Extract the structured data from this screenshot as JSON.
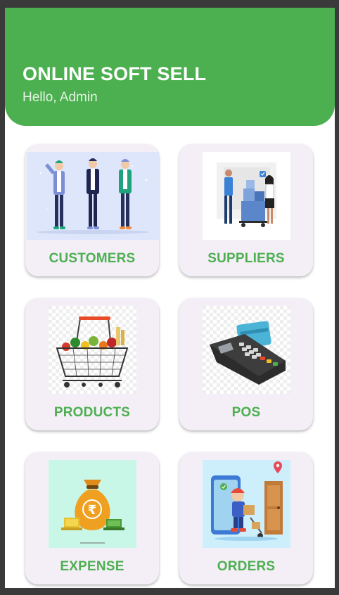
{
  "header": {
    "title": "ONLINE SOFT SELL",
    "greeting": "Hello, Admin",
    "background_color": "#4caf50"
  },
  "menu": {
    "label_color": "#4caf50",
    "card_color": "#f4eff7",
    "items": [
      {
        "label": "CUSTOMERS",
        "icon": "customers-illustration-icon"
      },
      {
        "label": "SUPPLIERS",
        "icon": "suppliers-illustration-icon"
      },
      {
        "label": "PRODUCTS",
        "icon": "shopping-basket-icon"
      },
      {
        "label": "POS",
        "icon": "card-payment-terminal-icon"
      },
      {
        "label": "EXPENSE",
        "icon": "rupee-money-bag-icon"
      },
      {
        "label": "ORDERS",
        "icon": "delivery-person-icon"
      }
    ]
  }
}
